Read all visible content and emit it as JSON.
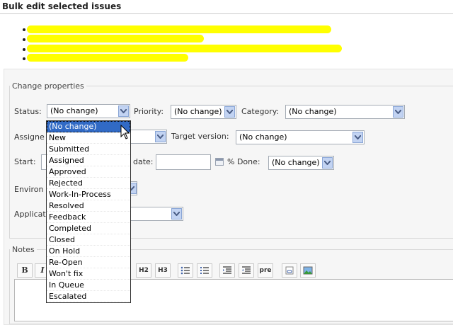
{
  "page": {
    "title": "Bulk edit selected issues"
  },
  "section": {
    "legend": "Change properties"
  },
  "fields": {
    "status_label": "Status:",
    "status_value": "(No change)",
    "priority_label": "Priority:",
    "priority_value": "(No change)",
    "category_label": "Category:",
    "category_value": "(No change)",
    "assignee_label": "Assigne",
    "target_version_label": "Target version:",
    "target_version_value": "(No change)",
    "start_label": "Start:",
    "due_label": "date:",
    "done_label": "% Done:",
    "done_value": "(No change)",
    "environment_label": "Environ",
    "application_label": "Applicat"
  },
  "notes": {
    "label": "Notes"
  },
  "toolbar": {
    "bold": "B",
    "italic": "I",
    "h2": "H2",
    "h3": "H3",
    "pre": "pre"
  },
  "status_dropdown": {
    "options": [
      "(No change)",
      "New",
      "Submitted",
      "Assigned",
      "Approved",
      "Rejected",
      "Work-In-Process",
      "Resolved",
      "Feedback",
      "Completed",
      "Closed",
      "On Hold",
      "Re-Open",
      "Won't fix",
      "In Queue",
      "Escalated"
    ],
    "highlighted": "(No change)"
  },
  "colors": {
    "highlight": "#316ac5",
    "redaction": "#ffff00",
    "arrow_bg": "#c2d3f2"
  }
}
